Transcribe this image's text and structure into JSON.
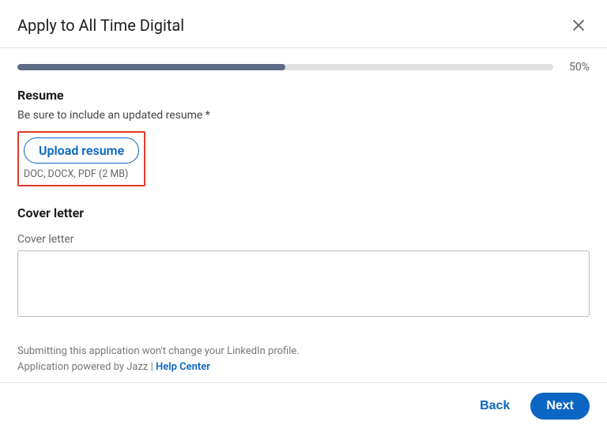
{
  "header": {
    "title": "Apply to All Time Digital"
  },
  "progress": {
    "percent_label": "50%",
    "percent_value": 50
  },
  "resume": {
    "heading": "Resume",
    "helper": "Be sure to include an updated resume  *",
    "upload_label": "Upload resume",
    "file_hint": "DOC, DOCX, PDF (2 MB)"
  },
  "cover": {
    "heading": "Cover letter",
    "field_label": "Cover letter",
    "value": ""
  },
  "disclaimer": {
    "line1": "Submitting this application won't change your LinkedIn profile.",
    "line2_prefix": "Application powered by Jazz | ",
    "help_link": "Help Center"
  },
  "footer": {
    "back_label": "Back",
    "next_label": "Next"
  }
}
